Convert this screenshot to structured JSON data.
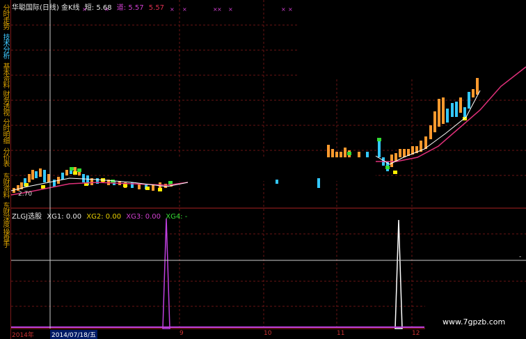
{
  "sidebar": {
    "tabs": [
      {
        "label": "分时走势",
        "color": "#d8a000"
      },
      {
        "label": "技术分析",
        "color": "#3ec9ff"
      },
      {
        "label": "基本资料",
        "color": "#d8a000"
      },
      {
        "label": "财务透视",
        "color": "#d8a000"
      },
      {
        "label": "分时明细",
        "color": "#d8a000"
      },
      {
        "label": "分价表",
        "color": "#d8a000"
      },
      {
        "label": "东财资料",
        "color": "#d8a000"
      },
      {
        "label": "东财深度",
        "color": "#d8a000"
      },
      {
        "label": "操盘手",
        "color": "#d8a000"
      }
    ]
  },
  "price_panel": {
    "stock_name": "华聪国际(日线)",
    "indicator": "金K线",
    "short_label": "短:",
    "short_value": "5.68",
    "dao_label": "道:",
    "dao_value": "5.57",
    "last_value": "5.57",
    "low_label": "2.70",
    "axis_marker_right": "-"
  },
  "indicator_panel": {
    "name": "ZLGJ选股",
    "xg1": "XG1: 0.00",
    "xg2": "XG2: 0.00",
    "xg3": "XG3: 0.00",
    "xg4": "XG4: -"
  },
  "x_axis": {
    "year_label": "2014年",
    "cursor_date": "2014/07/18/五",
    "month_ticks": [
      "9",
      "10",
      "11",
      "12"
    ]
  },
  "watermark": "www.7gpzb.com",
  "colors": {
    "background": "#000000",
    "grid": "#6a1515",
    "ma_pink": "#e0307a",
    "ma_white": "#ffffff",
    "up_candle": "#ff9a2e",
    "down_candle": "#33c8ff",
    "signal_purple": "#c040e0",
    "signal_white": "#ffffff",
    "yellow_marker": "#ffee00",
    "green_marker": "#33dd33"
  }
}
